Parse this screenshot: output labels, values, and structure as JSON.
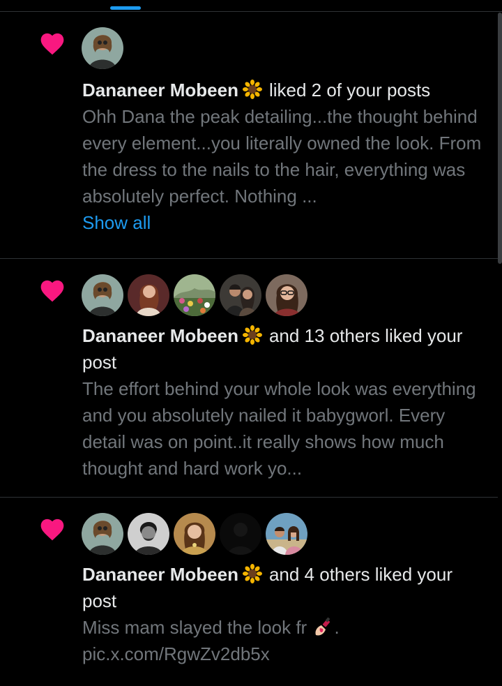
{
  "colors": {
    "background": "#000000",
    "divider": "#2f3336",
    "primary_text": "#e7e9ea",
    "secondary_text": "#71767b",
    "accent_blue": "#1d9bf0",
    "heart_pink": "#f91880"
  },
  "notifications": [
    {
      "icon": "heart-icon",
      "avatar_count": 1,
      "user_name": "Dananeer Mobeen",
      "name_emoji": "sunflower-emoji",
      "action_text": "liked 2 of your posts",
      "preview": "Ohh Dana the peak detailing...the thought behind every element...you literally owned the look. From the dress to the nails to the hair, everything was absolutely perfect. Nothing ...",
      "show_all_label": "Show all"
    },
    {
      "icon": "heart-icon",
      "avatar_count": 5,
      "user_name": "Dananeer Mobeen",
      "name_emoji": "sunflower-emoji",
      "action_text": "and 13 others liked your post",
      "preview": "The effort behind your whole look was everything and you absolutely nailed it babygworl. Every detail was on point..it really shows how much thought and hard work yo..."
    },
    {
      "icon": "heart-icon",
      "avatar_count": 5,
      "user_name": "Dananeer Mobeen",
      "name_emoji": "sunflower-emoji",
      "action_text": "and 4 others liked your post",
      "preview_before_emoji": "Miss mam slayed the look fr ",
      "preview_emoji": "nail-polish-emoji",
      "preview_after_emoji": ". pic.x.com/RgwZv2db5x"
    }
  ]
}
